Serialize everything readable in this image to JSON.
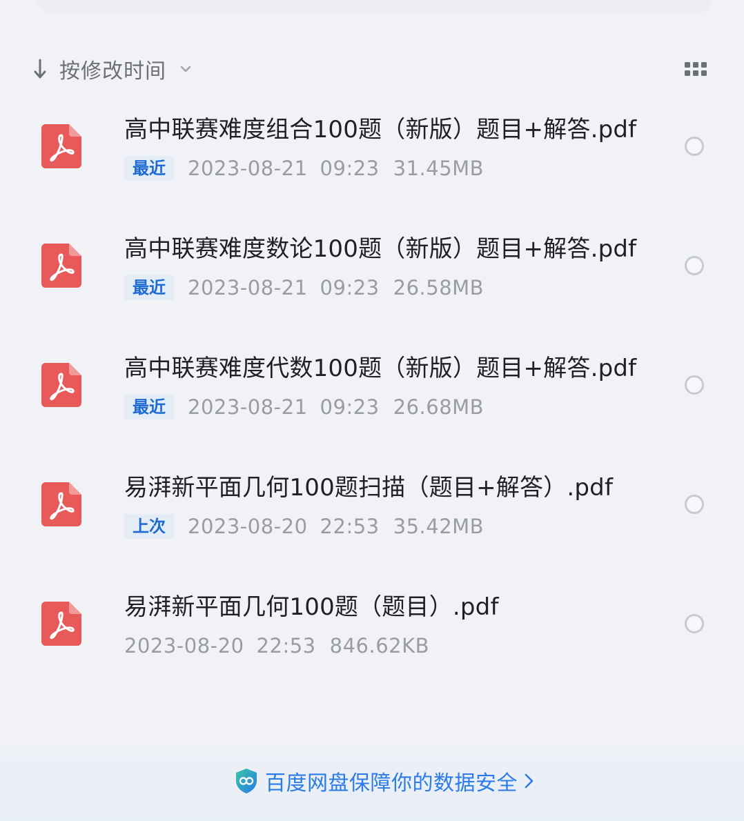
{
  "sort": {
    "label": "按修改时间",
    "direction_icon": "arrow-down-icon",
    "dropdown_icon": "chevron-down-icon",
    "view_icon": "grid-view-icon"
  },
  "files": [
    {
      "name": "高中联赛难度组合100题（新版）题目+解答.pdf",
      "badge": "最近",
      "date": "2023-08-21",
      "time": "09:23",
      "size": "31.45MB",
      "icon": "pdf-file-icon"
    },
    {
      "name": "高中联赛难度数论100题（新版）题目+解答.pdf",
      "badge": "最近",
      "date": "2023-08-21",
      "time": "09:23",
      "size": "26.58MB",
      "icon": "pdf-file-icon"
    },
    {
      "name": "高中联赛难度代数100题（新版）题目+解答.pdf",
      "badge": "最近",
      "date": "2023-08-21",
      "time": "09:23",
      "size": "26.68MB",
      "icon": "pdf-file-icon"
    },
    {
      "name": "易湃新平面几何100题扫描（题目+解答）.pdf",
      "badge": "上次",
      "date": "2023-08-20",
      "time": "22:53",
      "size": "35.42MB",
      "icon": "pdf-file-icon"
    },
    {
      "name": "易湃新平面几何100题（题目）.pdf",
      "badge": "",
      "date": "2023-08-20",
      "time": "22:53",
      "size": "846.62KB",
      "icon": "pdf-file-icon"
    }
  ],
  "footer": {
    "security_text": "百度网盘保障你的数据安全",
    "icon": "shield-icon"
  },
  "colors": {
    "background": "#f1f2f6",
    "pdf_red": "#e85a5a",
    "badge_blue": "#1e6bd6",
    "link_blue": "#2b7be9",
    "meta_gray": "#9a9ca4"
  }
}
